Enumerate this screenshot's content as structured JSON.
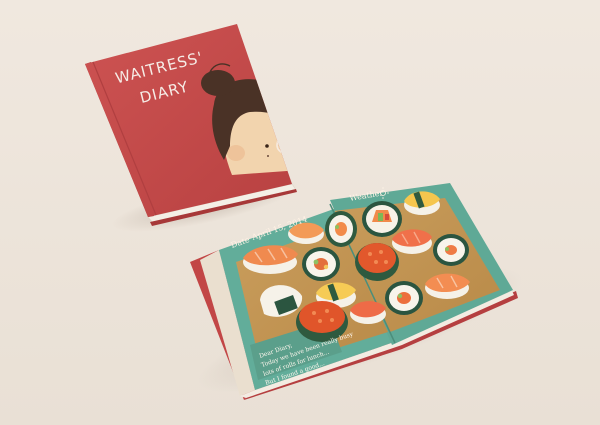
{
  "cover_book": {
    "title_line1": "WAITRESS'",
    "title_line2": "DIARY"
  },
  "open_book": {
    "date_label": "Date",
    "date_value": "April 15, 2014",
    "weather_label": "Weather",
    "note_lines": [
      "Dear Diary,",
      "Today we have been really busy",
      "lots of rolls for lunch...",
      "But I found a good..."
    ]
  },
  "colors": {
    "background": "#eee6dd",
    "cover_red": "#c64a4b",
    "page_teal": "#62ad9a",
    "table_wood": "#c29452"
  }
}
